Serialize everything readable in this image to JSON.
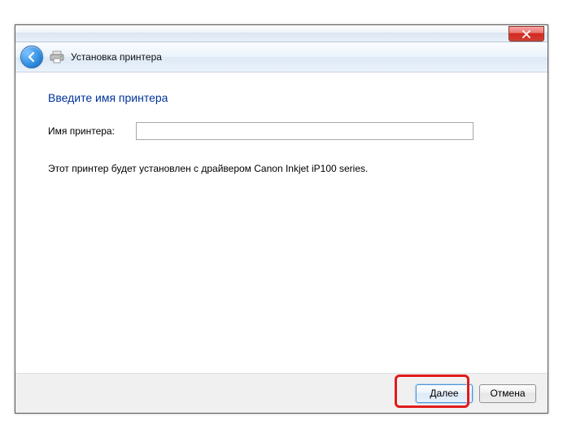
{
  "window": {
    "title": "Установка принтера"
  },
  "page": {
    "heading": "Введите имя принтера",
    "printer_name_label": "Имя принтера:",
    "printer_name_value": "",
    "info_text": "Этот принтер будет установлен с драйвером Canon Inkjet iP100 series."
  },
  "buttons": {
    "next": "Далее",
    "cancel": "Отмена"
  }
}
